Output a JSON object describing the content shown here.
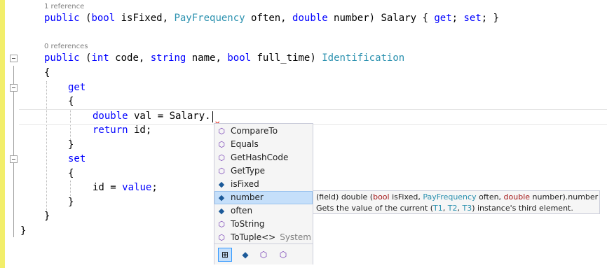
{
  "editor": {
    "lens1": "1 reference",
    "lens2": "0 references",
    "line1": {
      "public": "public",
      "open": " (",
      "bool": "bool",
      "isFixed": " isFixed, ",
      "PayFrequency": "PayFrequency",
      "often": " often, ",
      "double": "double",
      "rest": " number) Salary { ",
      "get": "get",
      "semi1": "; ",
      "set": "set",
      "end": "; }"
    },
    "line2": {
      "public": "public",
      "open": " (",
      "int": "int",
      "code": " code, ",
      "string": "string",
      "name": " name, ",
      "bool": "bool",
      "rest": " full_time) ",
      "type": "Identification"
    },
    "brace_open": "{",
    "get": "get",
    "get_brace_open": "{",
    "assign": {
      "double": "double",
      "rest": " val = Salary."
    },
    "return_kw": "return",
    "return_rest": " id;",
    "get_brace_close": "}",
    "set": "set",
    "set_brace_open": "{",
    "set_stmt_id": "id = ",
    "set_stmt_value": "value",
    "set_stmt_end": ";",
    "set_brace_close": "}",
    "prop_close": "}",
    "class_close": "}",
    "squiggle": "✕"
  },
  "completion": {
    "items": [
      {
        "label": "CompareTo",
        "kind": "method"
      },
      {
        "label": "Equals",
        "kind": "method"
      },
      {
        "label": "GetHashCode",
        "kind": "method"
      },
      {
        "label": "GetType",
        "kind": "method"
      },
      {
        "label": "isFixed",
        "kind": "field"
      },
      {
        "label": "number",
        "kind": "field",
        "selected": true
      },
      {
        "label": "often",
        "kind": "field"
      },
      {
        "label": "ToString",
        "kind": "method"
      },
      {
        "label": "ToTuple<>",
        "kind": "extension",
        "namespace": "System"
      }
    ],
    "filters": [
      "all-filter",
      "field-filter",
      "method-filter",
      "extension-filter"
    ]
  },
  "tooltip": {
    "l1_prefix": "(field) double (",
    "l1_bool": "bool",
    "l1_isFixed": " isFixed, ",
    "l1_PayFrequency": "PayFrequency",
    "l1_often": " often, ",
    "l1_double": "double",
    "l1_suffix": " number).number",
    "l2_prefix": "Gets the value of the current (",
    "l2_T1": "T1",
    "l2_sep1": ", ",
    "l2_T2": "T2",
    "l2_sep2": ", ",
    "l2_T3": "T3",
    "l2_suffix": ") instance's third element."
  },
  "colors": {
    "keyword": "#0000ff",
    "control_keyword": "#c00000",
    "type": "#2b91af",
    "selection": "#c5dffa",
    "change_margin": "#f2ee6a"
  }
}
